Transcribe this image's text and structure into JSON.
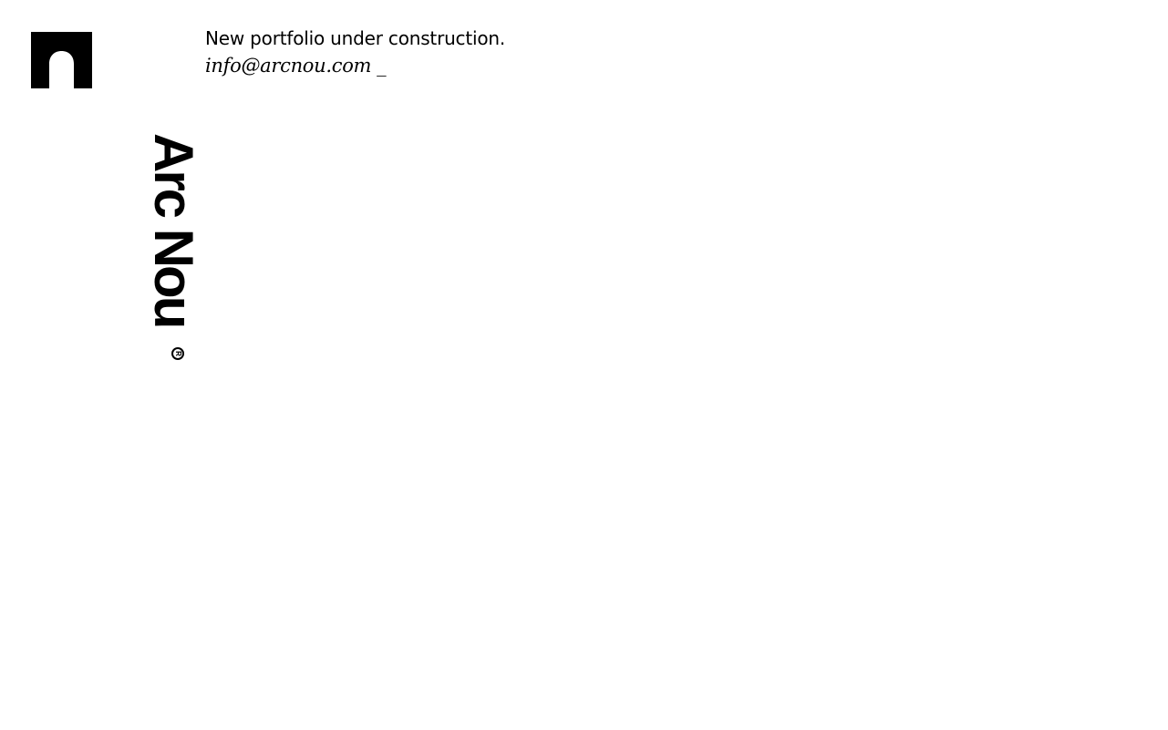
{
  "logo": {
    "icon": "arch-logo-icon",
    "color": "#000000"
  },
  "message": {
    "tagline": "New portfolio under construction.",
    "email": "info@arcnou.com",
    "cursor": "_"
  },
  "brand": {
    "name": "Arc Nou",
    "registered_mark": "R"
  },
  "colors": {
    "background": "#ffffff",
    "text": "#000000"
  }
}
